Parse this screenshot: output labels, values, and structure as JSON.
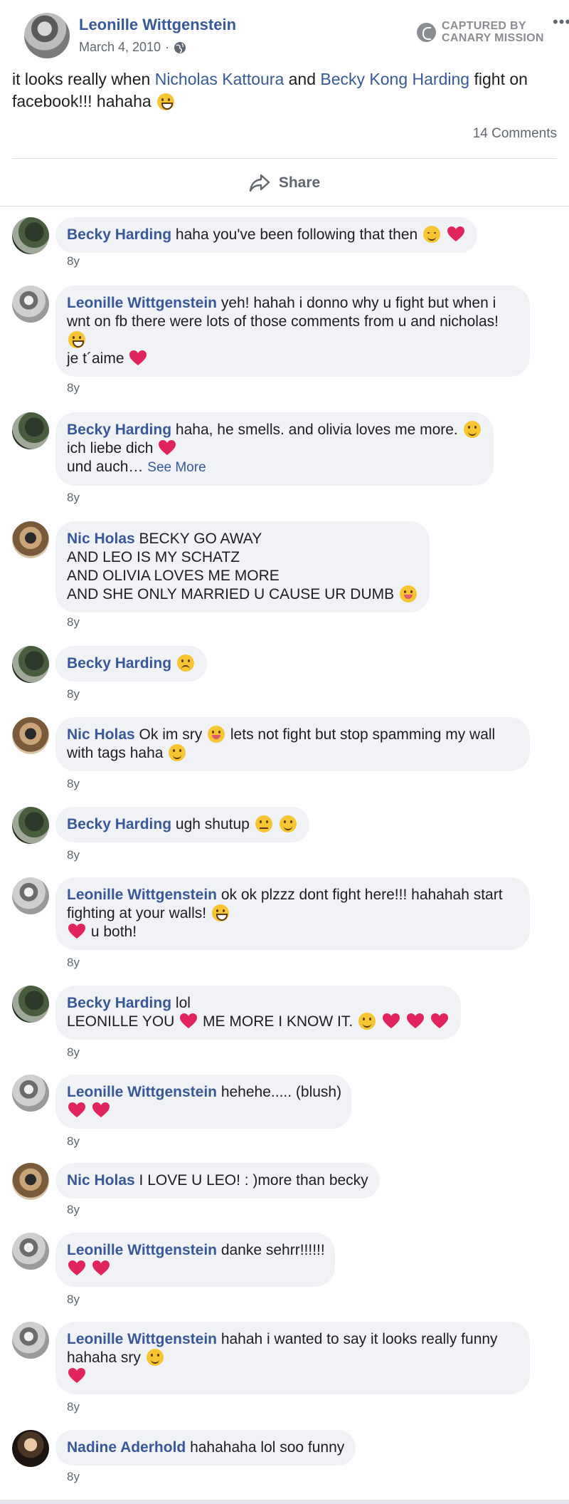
{
  "post": {
    "author": "Leonille Wittgenstein",
    "date": "March 4, 2010",
    "meta_separator": "·",
    "captured_line1": "CAPTURED BY",
    "captured_line2": "CANARY MISSION",
    "more_options": "•••",
    "text_part1": "it looks really when ",
    "link1": "Nicholas Kattoura",
    "text_part2": " and ",
    "link2": "Becky Kong Harding",
    "text_part3": " fight on facebook!!! hahaha",
    "comment_count": "14 Comments",
    "share_label": "Share"
  },
  "comments": [
    {
      "name": "Becky Harding",
      "line1": "haha you've been following that then",
      "time": "8y"
    },
    {
      "name": "Leonille Wittgenstein",
      "line1": "yeh! hahah i donno why u fight but when i",
      "line2": "wnt on fb there were lots of those comments from u and nicholas!",
      "line3": "je t´aime",
      "time": "8y"
    },
    {
      "name": "Becky Harding",
      "line1": "haha, he smells. and olivia loves me more.",
      "line2": "ich liebe dich",
      "line3": "und auch…",
      "see_more": "See More",
      "time": "8y"
    },
    {
      "name": "Nic Holas",
      "line1": "BECKY GO AWAY",
      "line2": "AND LEO IS MY SCHATZ",
      "line3": "AND OLIVIA LOVES ME MORE",
      "line4": "AND SHE ONLY MARRIED U CAUSE UR DUMB",
      "time": "8y"
    },
    {
      "name": "Becky Harding",
      "time": "8y"
    },
    {
      "name": "Nic Holas",
      "line1": "Ok im sry",
      "line1b": "lets not fight but stop spamming my wall",
      "line2": "with tags haha",
      "time": "8y"
    },
    {
      "name": "Becky Harding",
      "line1": "ugh shutup",
      "time": "8y"
    },
    {
      "name": "Leonille Wittgenstein",
      "line1": "ok ok plzzz dont fight here!!! hahahah start",
      "line2": "fighting at your walls!",
      "line3": "u both!",
      "time": "8y"
    },
    {
      "name": "Becky Harding",
      "line1": "lol",
      "line2a": "LEONILLE YOU",
      "line2b": "ME MORE I KNOW IT.",
      "time": "8y"
    },
    {
      "name": "Leonille Wittgenstein",
      "line1": "hehehe..... (blush)",
      "time": "8y"
    },
    {
      "name": "Nic Holas",
      "line1": "I LOVE U LEO! : )more than becky",
      "time": "8y"
    },
    {
      "name": "Leonille Wittgenstein",
      "line1": "danke sehrr!!!!!!",
      "time": "8y"
    },
    {
      "name": "Leonille Wittgenstein",
      "line1": "hahah i wanted to say it looks really funny",
      "line2": "hahaha sry",
      "time": "8y"
    },
    {
      "name": "Nadine Aderhold",
      "line1": "hahahaha lol soo funny",
      "time": "8y"
    }
  ],
  "icons": {
    "globe": "globe-icon",
    "share": "share-arrow-icon",
    "heart_color": "#e0245e",
    "emoji_color": "#f7c531",
    "link_color": "#385898"
  }
}
